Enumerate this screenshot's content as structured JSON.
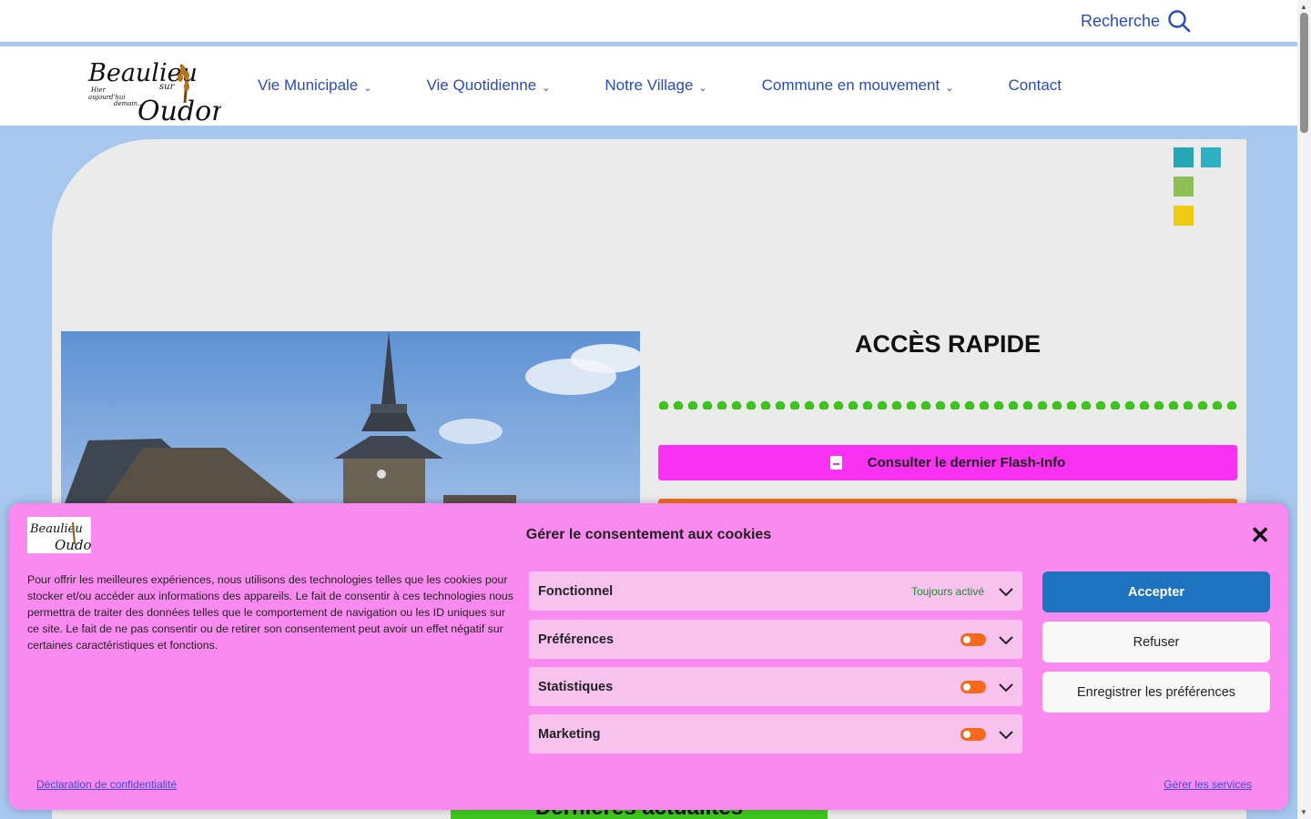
{
  "header": {
    "search_label": "Recherche"
  },
  "logo": {
    "line1": "Beaulieu",
    "line2": "sur",
    "line3": "Oudon",
    "tagline1": "Hier",
    "tagline2": "aujourd'hui",
    "tagline3": "demain..."
  },
  "nav": {
    "items": [
      {
        "label": "Vie Municipale",
        "dropdown": true
      },
      {
        "label": "Vie Quotidienne",
        "dropdown": true
      },
      {
        "label": "Notre Village",
        "dropdown": true
      },
      {
        "label": "Commune en mouvement",
        "dropdown": true
      },
      {
        "label": "Contact",
        "dropdown": false
      }
    ]
  },
  "colors": {
    "page_bg": "#a7c8ee",
    "nav_text": "#2a4bb7",
    "teal": "#27a7b3",
    "green_square": "#8dbf54",
    "yellow_square": "#f0cb16",
    "flash_btn": "#f931f2",
    "orange_btn": "#f2701d",
    "news_btn": "#3fc91f",
    "cookie_bg": "#fb8af0",
    "accept_btn": "#1e73be",
    "toggle": "#f36a1c"
  },
  "quick_access": {
    "title": "ACCÈS RAPIDE",
    "flash_button_label": "Consulter le dernier Flash-Info"
  },
  "news": {
    "label": "Dernières actualités"
  },
  "cookie": {
    "title": "Gérer le consentement aux cookies",
    "text": "Pour offrir les meilleures expériences, nous utilisons des technologies telles que les cookies pour stocker et/ou accéder aux informations des appareils. Le fait de consentir à ces technologies nous permettra de traiter des données telles que le comportement de navigation ou les ID uniques sur ce site. Le fait de ne pas consentir ou de retirer son consentement peut avoir un effet négatif sur certaines caractéristiques et fonctions.",
    "categories": [
      {
        "label": "Fonctionnel",
        "status": "Toujours activé"
      },
      {
        "label": "Préférences"
      },
      {
        "label": "Statistiques"
      },
      {
        "label": "Marketing"
      }
    ],
    "accept_label": "Accepter",
    "refuse_label": "Refuser",
    "save_label": "Enregistrer les préférences",
    "privacy_link": "Déclaration de confidentialité",
    "services_link": "Gérer les services"
  }
}
